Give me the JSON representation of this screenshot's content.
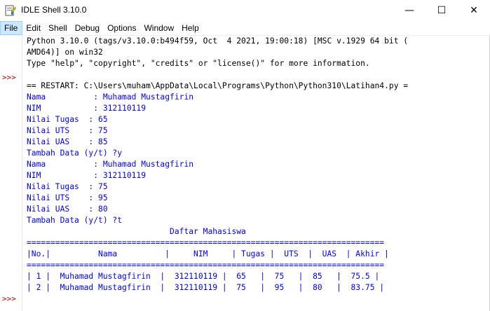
{
  "window": {
    "title": "IDLE Shell 3.10.0",
    "minimize_glyph": "—",
    "maximize_glyph": "☐",
    "close_glyph": "✕"
  },
  "menu": [
    "File",
    "Edit",
    "Shell",
    "Debug",
    "Options",
    "Window",
    "Help"
  ],
  "prompts": [
    ">>>",
    ">>>"
  ],
  "lines": [
    {
      "cls": "out",
      "text": "Python 3.10.0 (tags/v3.10.0:b494f59, Oct  4 2021, 19:00:18) [MSC v.1929 64 bit ("
    },
    {
      "cls": "out",
      "text": "AMD64)] on win32"
    },
    {
      "cls": "out",
      "text": "Type \"help\", \"copyright\", \"credits\" or \"license()\" for more information."
    },
    {
      "cls": "out",
      "text": ""
    },
    {
      "cls": "out",
      "text": "== RESTART: C:\\Users\\muham\\AppData\\Local\\Programs\\Python\\Python310\\Latihan4.py ="
    },
    {
      "cls": "stdout",
      "text": "Nama          : Muhamad Mustagfirin"
    },
    {
      "cls": "stdout",
      "text": "NIM           : 312110119"
    },
    {
      "cls": "stdout",
      "text": "Nilai Tugas  : 65"
    },
    {
      "cls": "stdout",
      "text": "Nilai UTS    : 75"
    },
    {
      "cls": "stdout",
      "text": "Nilai UAS    : 85"
    },
    {
      "cls": "stdout",
      "text": "Tambah Data (y/t) ?y"
    },
    {
      "cls": "stdout",
      "text": "Nama          : Muhamad Mustagfirin"
    },
    {
      "cls": "stdout",
      "text": "NIM           : 312110119"
    },
    {
      "cls": "stdout",
      "text": "Nilai Tugas  : 75"
    },
    {
      "cls": "stdout",
      "text": "Nilai UTS    : 95"
    },
    {
      "cls": "stdout",
      "text": "Nilai UAS    : 80"
    },
    {
      "cls": "stdout",
      "text": "Tambah Data (y/t) ?t"
    },
    {
      "cls": "stdout",
      "text": "                              Daftar Mahasiswa"
    },
    {
      "cls": "stdout",
      "text": "==========================================================================="
    },
    {
      "cls": "stdout",
      "text": "|No.|          Nama          |     NIM     | Tugas |  UTS  |  UAS  | Akhir |"
    },
    {
      "cls": "stdout",
      "text": "==========================================================================="
    },
    {
      "cls": "stdout",
      "text": "| 1 |  Muhamad Mustagfirin  |  312110119 |  65   |  75   |  85   |  75.5 |"
    },
    {
      "cls": "stdout",
      "text": "| 2 |  Muhamad Mustagfirin  |  312110119 |  75   |  95   |  80   |  83.75 |"
    },
    {
      "cls": "out",
      "text": ""
    }
  ]
}
